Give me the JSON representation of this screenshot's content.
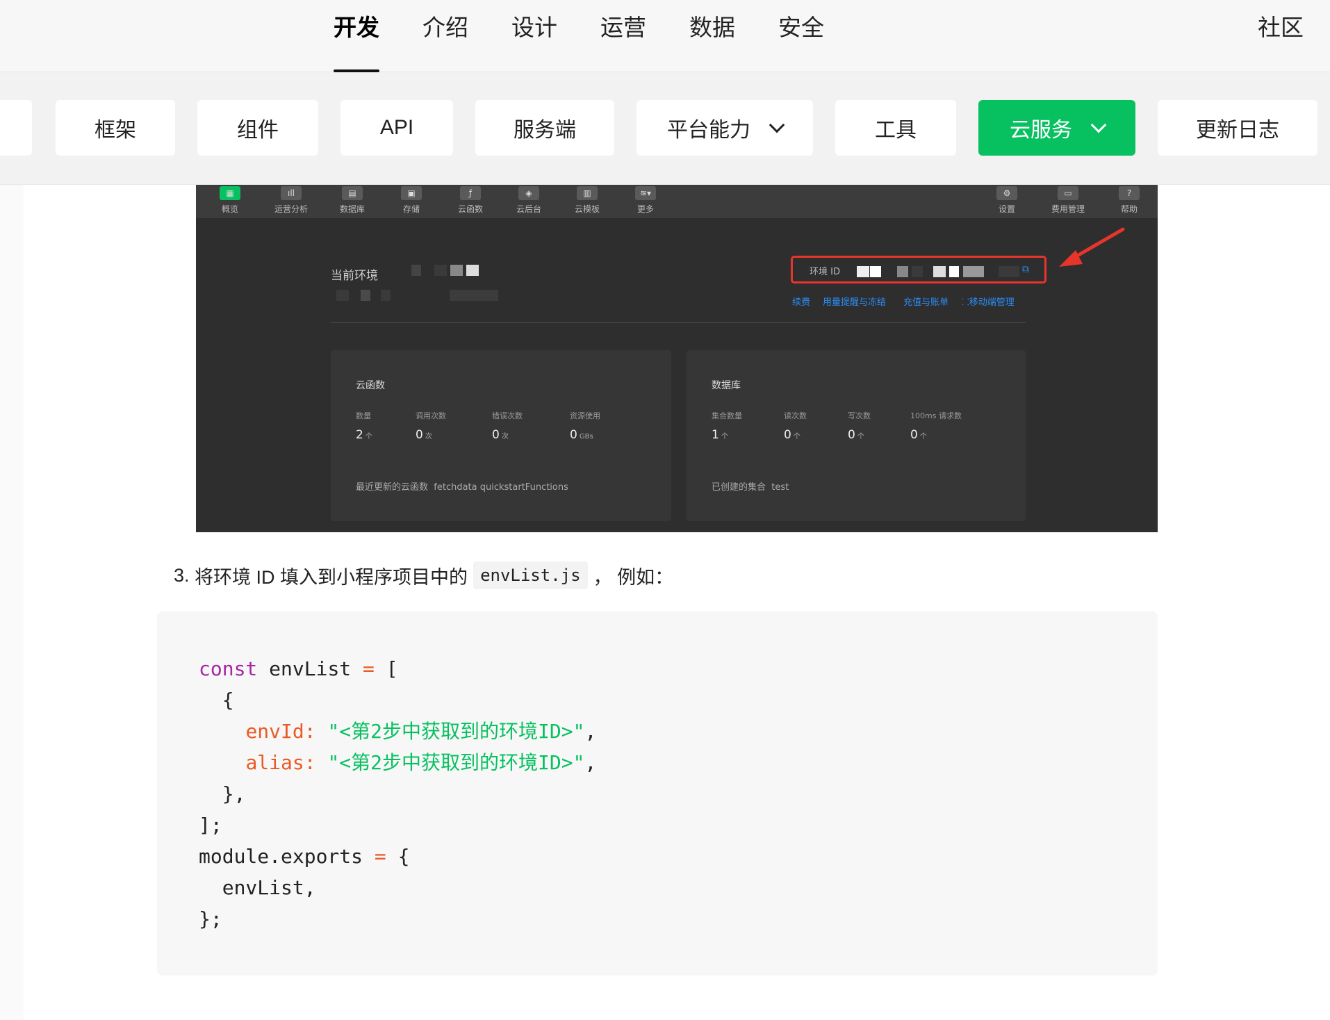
{
  "top_tabs": [
    "开发",
    "介绍",
    "设计",
    "运营",
    "数据",
    "安全"
  ],
  "community_link": "社区",
  "sub_pills": [
    "框架",
    "组件",
    "API",
    "服务端",
    "平台能力",
    "工具",
    "云服务",
    "更新日志"
  ],
  "console": {
    "toolbar": [
      "概览",
      "运营分析",
      "数据库",
      "存储",
      "云函数",
      "云后台",
      "云模板",
      "更多"
    ],
    "toolbar_right": [
      "设置",
      "费用管理",
      "帮助"
    ],
    "current_env_label": "当前环境",
    "env_id_label": "环境 ID",
    "links": [
      "续费",
      "用量提醒与冻结",
      "充值与账单",
      "移动端管理"
    ],
    "cloud_functions": {
      "title": "云函数",
      "metrics": [
        {
          "label": "数量",
          "value": "2",
          "unit": "个"
        },
        {
          "label": "调用次数",
          "value": "0",
          "unit": "次"
        },
        {
          "label": "错误次数",
          "value": "0",
          "unit": "次"
        },
        {
          "label": "资源使用",
          "value": "0",
          "unit": "GBs"
        }
      ],
      "footer_label": "最近更新的云函数",
      "footer_value": "fetchdata quickstartFunctions"
    },
    "database": {
      "title": "数据库",
      "metrics": [
        {
          "label": "集合数量",
          "value": "1",
          "unit": "个"
        },
        {
          "label": "读次数",
          "value": "0",
          "unit": "个"
        },
        {
          "label": "写次数",
          "value": "0",
          "unit": "个"
        },
        {
          "label": "100ms 请求数",
          "value": "0",
          "unit": "个"
        }
      ],
      "footer_label": "已创建的集合",
      "footer_value": "test"
    },
    "accent_color": "#07c160",
    "highlight_color": "#e8352b"
  },
  "step": {
    "number": "3.",
    "text": "将环境 ID 填入到小程序项目中的",
    "code": "envList.js",
    "suffix": "，  例如："
  },
  "code": {
    "kw_const": "const",
    "var_name": "envList",
    "eq": "=",
    "envId_key": "envId:",
    "alias_key": "alias:",
    "placeholder": "\"<第2步中获取到的环境ID>\"",
    "module_exports": "module.exports",
    "envList_ref": "envList,"
  }
}
